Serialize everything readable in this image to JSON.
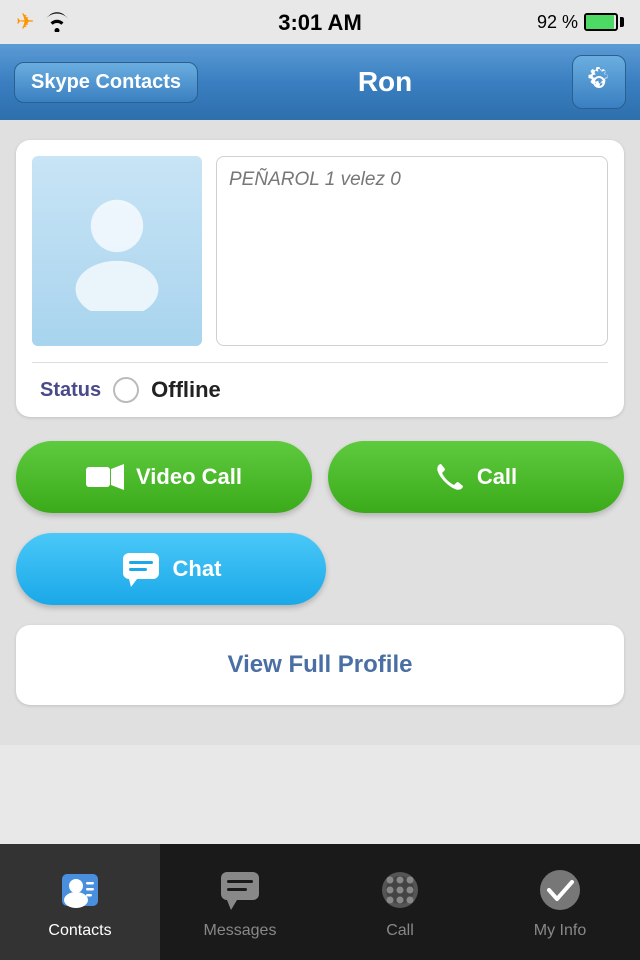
{
  "statusBar": {
    "time": "3:01 AM",
    "batteryPercent": "92 %"
  },
  "header": {
    "backButton": "Skype Contacts",
    "title": "Ron",
    "settingsLabel": "Settings"
  },
  "profile": {
    "statusMessage": "PEÑAROL 1 velez 0",
    "statusLabel": "Status",
    "statusValue": "Offline"
  },
  "actions": {
    "videoCallLabel": "Video Call",
    "callLabel": "Call",
    "chatLabel": "Chat",
    "viewProfileLabel": "View Full Profile"
  },
  "tabBar": {
    "tabs": [
      {
        "id": "contacts",
        "label": "Contacts",
        "active": true
      },
      {
        "id": "messages",
        "label": "Messages",
        "active": false
      },
      {
        "id": "call",
        "label": "Call",
        "active": false
      },
      {
        "id": "myinfo",
        "label": "My Info",
        "active": false
      }
    ]
  }
}
